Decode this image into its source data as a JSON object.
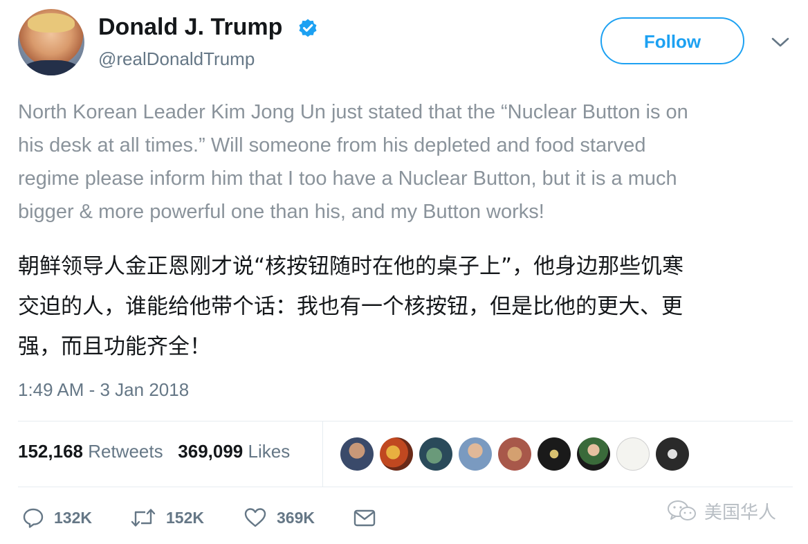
{
  "author": {
    "name": "Donald J. Trump",
    "handle": "@realDonaldTrump",
    "verified": true
  },
  "follow_button": {
    "label": "Follow"
  },
  "tweet": {
    "text_en_lines": [
      "North Korean Leader Kim Jong Un just stated that the “Nuclear Button is on",
      "his desk at all times.” Will someone from his depleted and food starved",
      "regime please inform him that I too have a Nuclear Button, but it is a much",
      "bigger & more powerful one than his, and my Button works!"
    ],
    "text_zh_lines": [
      "朝鲜领导人金正恩刚才说“核按钮随时在他的桌子上”，他身边那些饥寒",
      "交迫的人，谁能给他带个话：我也有一个核按钮，但是比他的更大、更",
      "强，而且功能齐全！"
    ],
    "timestamp": "1:49 AM - 3 Jan 2018"
  },
  "stats": {
    "retweets_count": "152,168",
    "retweets_label": "Retweets",
    "likes_count": "369,099",
    "likes_label": "Likes"
  },
  "actions": {
    "reply_count": "132K",
    "retweet_count": "152K",
    "like_count": "369K"
  },
  "watermark": {
    "text": "美国华人"
  },
  "colors": {
    "accent": "#1da1f2",
    "muted_text": "#657786",
    "body_text_en": "#8a939b",
    "divider": "#e6ecf0"
  }
}
